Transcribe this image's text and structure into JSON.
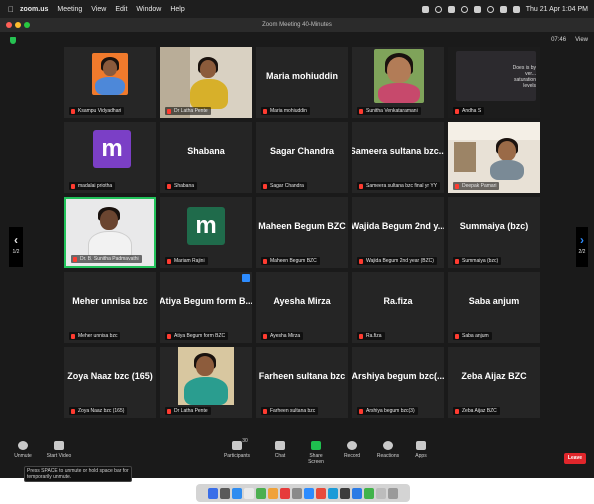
{
  "menubar": {
    "app": "zoom.us",
    "items": [
      "Meeting",
      "View",
      "Edit",
      "Window",
      "Help"
    ],
    "clock": "Thu 21 Apr 1:04 PM"
  },
  "window": {
    "title": "Zoom Meeting  40-Minutes"
  },
  "topbar": {
    "timer": "07:46",
    "view_label": "View"
  },
  "tiles": [
    {
      "name": "",
      "label": "Ksampu Vidyadhari",
      "type": "video",
      "variant": "orange"
    },
    {
      "name": "",
      "label": "Dr Latha Pente",
      "type": "video",
      "variant": "woman2"
    },
    {
      "name": "Maria mohiuddin",
      "label": "Maria mohiuddin",
      "type": "name"
    },
    {
      "name": "",
      "label": "Sunitha Venkataramani",
      "type": "video",
      "variant": "woman3"
    },
    {
      "name": "",
      "label": "Andha S",
      "type": "video",
      "variant": "dark",
      "overlay": "Does is by ver... saturation levels"
    },
    {
      "name": "",
      "label": "madalai priotha",
      "type": "avatar",
      "letter": "m",
      "color": "#7b3fc6"
    },
    {
      "name": "Shabana",
      "label": "Shabana",
      "type": "name"
    },
    {
      "name": "Sagar Chandra",
      "label": "Sagar Chandra",
      "type": "name"
    },
    {
      "name": "Sameera sultana bzc...",
      "label": "Sameera sultana bzc final yr YY",
      "type": "name"
    },
    {
      "name": "",
      "label": "Deepak Pamari",
      "type": "video",
      "variant": "room"
    },
    {
      "name": "",
      "label": "Dr. B. Sunitha Padmavathi",
      "type": "video",
      "variant": "woman5",
      "active": true
    },
    {
      "name": "",
      "label": "Mariam Rajini",
      "type": "avatar",
      "letter": "m",
      "color": "#1f6b4b"
    },
    {
      "name": "Maheen Begum BZC",
      "label": "Maheen Begum BZC",
      "type": "name"
    },
    {
      "name": "Wajida Begum 2nd y...",
      "label": "Wajida Begum 2nd year (BZC)",
      "type": "name"
    },
    {
      "name": "Summaiya (bzc)",
      "label": "Summaiya (bzc)",
      "type": "name"
    },
    {
      "name": "Meher unnisa bzc",
      "label": "Meher unnisa bzc",
      "type": "name"
    },
    {
      "name": "Atiya Begum form B...",
      "label": "Atiya Begum form BZC",
      "type": "name",
      "badge": true
    },
    {
      "name": "Ayesha Mirza",
      "label": "Ayesha Mirza",
      "type": "name"
    },
    {
      "name": "Ra.fiza",
      "label": "Ra.fiza",
      "type": "name"
    },
    {
      "name": "Saba anjum",
      "label": "Saba anjum",
      "type": "name"
    },
    {
      "name": "Zoya Naaz bzc (165)",
      "label": "Zoya Naaz bzc (165)",
      "type": "name"
    },
    {
      "name": "",
      "label": "Dr Latha Pente",
      "type": "video",
      "variant": "woman6"
    },
    {
      "name": "Farheen sultana bzc",
      "label": "Farheen sultana bzc",
      "type": "name"
    },
    {
      "name": "Arshiya begum bzc(...",
      "label": "Arshiya begum bzc(3)",
      "type": "name"
    },
    {
      "name": "Zeba Aijaz BZC",
      "label": "Zeba Aijaz BZC",
      "type": "name"
    }
  ],
  "nav": {
    "left_page": "1/2",
    "right_page": "2/2"
  },
  "toolbar": {
    "unmute": "Unmute",
    "start_video": "Start Video",
    "participants": "Participants",
    "participants_count": "30",
    "chat": "Chat",
    "share_screen": "Share Screen",
    "record": "Record",
    "reactions": "Reactions",
    "apps": "Apps",
    "leave": "Leave",
    "tooltip": "Press  SPACE to unmute or hold space bar for temporarily unmute."
  },
  "colors": {
    "active_speaker": "#21c25a",
    "share_screen": "#1fbf4f",
    "leave": "#e0262b",
    "mute": "#ff3b30"
  }
}
